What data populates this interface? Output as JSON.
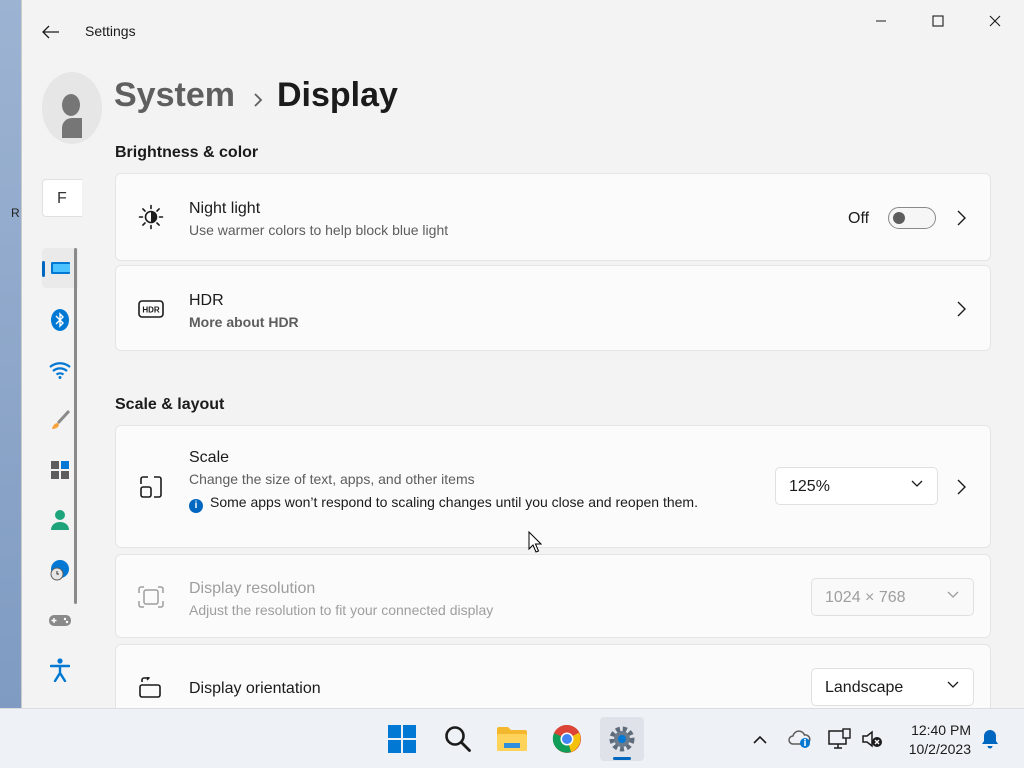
{
  "window": {
    "title": "Settings"
  },
  "desktop": {
    "edge_text": "R"
  },
  "nav": {
    "find_placeholder": "F"
  },
  "breadcrumb": {
    "parent": "System",
    "current": "Display"
  },
  "sections": {
    "brightness": "Brightness & color",
    "scale_layout": "Scale & layout"
  },
  "night_light": {
    "title": "Night light",
    "desc": "Use warmer colors to help block blue light",
    "state": "Off",
    "on": false
  },
  "hdr": {
    "title": "HDR",
    "link": "More about HDR"
  },
  "scale": {
    "title": "Scale",
    "desc": "Change the size of text, apps, and other items",
    "info": "Some apps won’t respond to scaling changes until you close and reopen them.",
    "value": "125%"
  },
  "resolution": {
    "title": "Display resolution",
    "desc": "Adjust the resolution to fit your connected display",
    "value": "1024 × 768"
  },
  "orientation": {
    "title": "Display orientation",
    "value": "Landscape"
  },
  "taskbar": {
    "time": "12:40 PM",
    "date": "10/2/2023"
  },
  "colors": {
    "accent": "#0067c0",
    "link": "#003e92",
    "window_bg": "#f3f3f3",
    "card_bg": "#fbfbfb"
  }
}
